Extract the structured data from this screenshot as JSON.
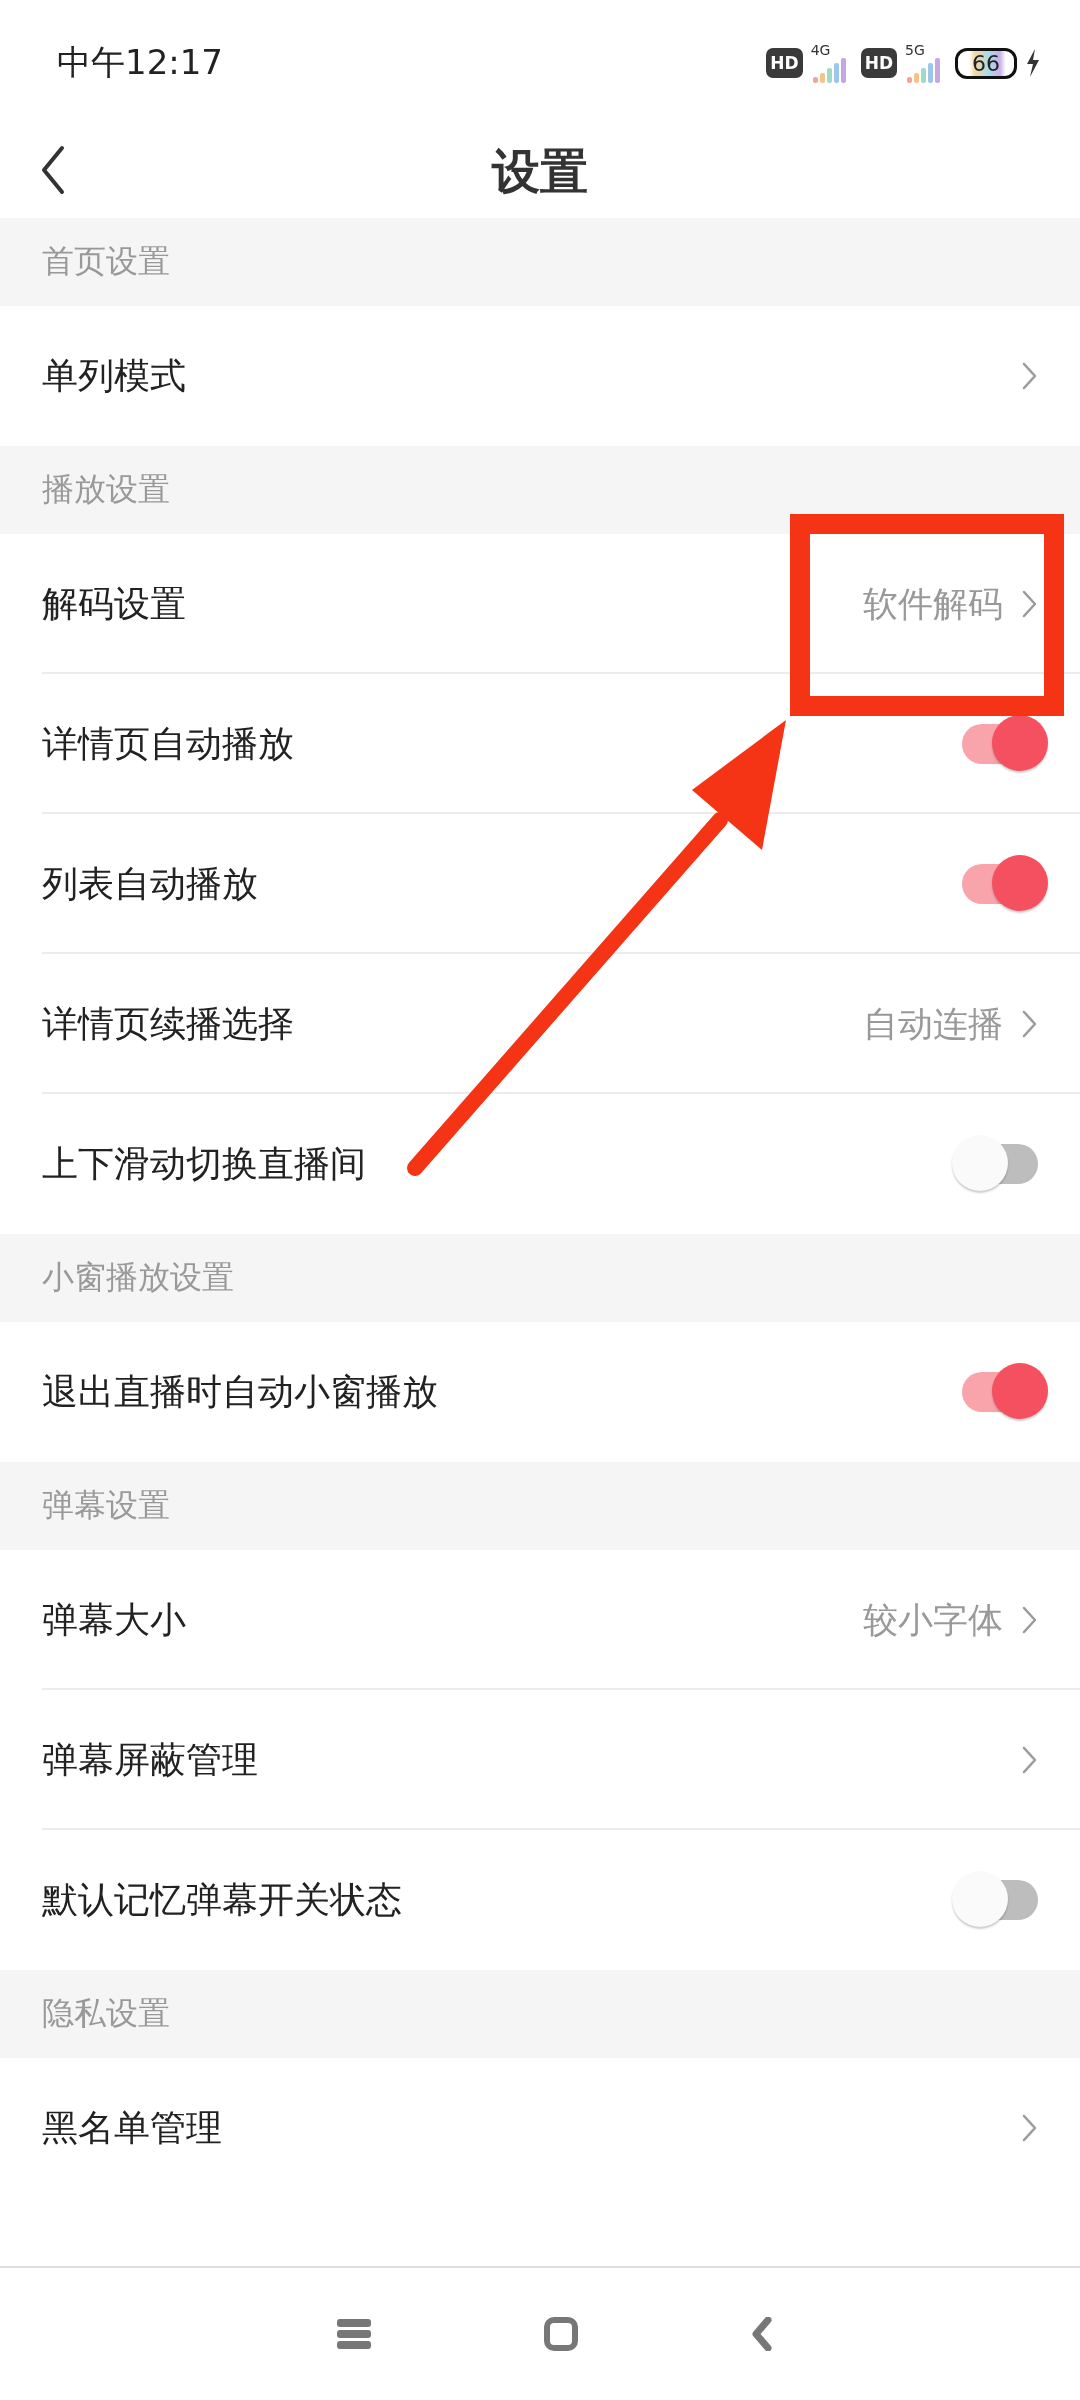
{
  "status_bar": {
    "time": "中午12:17",
    "sims": [
      {
        "badge": "HD",
        "network": "4G"
      },
      {
        "badge": "HD",
        "network": "5G"
      }
    ],
    "battery": "66",
    "charging": true
  },
  "header": {
    "title": "设置"
  },
  "sections": [
    {
      "title": "首页设置",
      "rows": [
        {
          "kind": "link",
          "label": "单列模式",
          "highlighted": false
        }
      ]
    },
    {
      "title": "播放设置",
      "rows": [
        {
          "kind": "link",
          "label": "解码设置",
          "value": "软件解码",
          "highlighted": true
        },
        {
          "kind": "toggle",
          "label": "详情页自动播放",
          "on": true,
          "highlighted": false
        },
        {
          "kind": "toggle",
          "label": "列表自动播放",
          "on": true,
          "highlighted": false
        },
        {
          "kind": "link",
          "label": "详情页续播选择",
          "value": "自动连播",
          "highlighted": false
        },
        {
          "kind": "toggle",
          "label": "上下滑动切换直播间",
          "on": false,
          "highlighted": false
        }
      ]
    },
    {
      "title": "小窗播放设置",
      "rows": [
        {
          "kind": "toggle",
          "label": "退出直播时自动小窗播放",
          "on": true,
          "highlighted": false
        }
      ]
    },
    {
      "title": "弹幕设置",
      "rows": [
        {
          "kind": "link",
          "label": "弹幕大小",
          "value": "较小字体",
          "highlighted": false
        },
        {
          "kind": "link",
          "label": "弹幕屏蔽管理",
          "highlighted": false
        },
        {
          "kind": "toggle",
          "label": "默认记忆弹幕开关状态",
          "on": false,
          "highlighted": false
        }
      ]
    },
    {
      "title": "隐私设置",
      "rows": [
        {
          "kind": "link",
          "label": "黑名单管理",
          "highlighted": false
        }
      ]
    }
  ],
  "annotation_arrow": true
}
